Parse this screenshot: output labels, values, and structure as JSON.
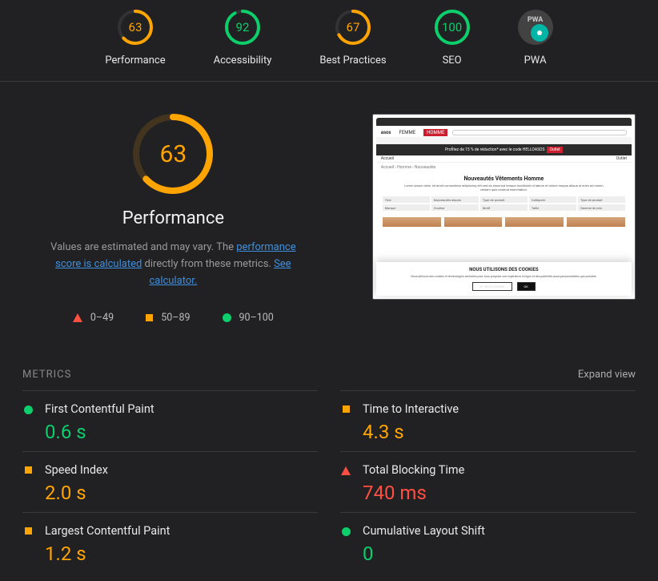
{
  "top_gauges": [
    {
      "score": 63,
      "label": "Performance",
      "color": "#ffa400"
    },
    {
      "score": 92,
      "label": "Accessibility",
      "color": "#0cce6b"
    },
    {
      "score": 67,
      "label": "Best Practices",
      "color": "#ffa400"
    },
    {
      "score": 100,
      "label": "SEO",
      "color": "#0cce6b"
    }
  ],
  "pwa_label": "PWA",
  "pwa_badge_text": "PWA",
  "big_gauge": {
    "score": 63,
    "label": "Performance",
    "color": "#ffa400"
  },
  "desc_prefix": "Values are estimated and may vary. The ",
  "desc_link1": "performance score is calculated",
  "desc_mid": " directly from these metrics. ",
  "desc_link2": "See calculator.",
  "legend": {
    "low": "0–49",
    "mid": "50–89",
    "high": "90–100"
  },
  "metrics_title": "METRICS",
  "expand_label": "Expand view",
  "metrics": [
    {
      "name": "First Contentful Paint",
      "value": "0.6 s",
      "status": "good"
    },
    {
      "name": "Time to Interactive",
      "value": "4.3 s",
      "status": "avg"
    },
    {
      "name": "Speed Index",
      "value": "2.0 s",
      "status": "avg"
    },
    {
      "name": "Total Blocking Time",
      "value": "740 ms",
      "status": "bad"
    },
    {
      "name": "Largest Contentful Paint",
      "value": "1.2 s",
      "status": "avg"
    },
    {
      "name": "Cumulative Layout Shift",
      "value": "0",
      "status": "good"
    }
  ],
  "screenshot": {
    "site": "asos",
    "tabs": [
      "FEMME",
      "HOMME"
    ],
    "banner": "Profitez de 15 % de réduction* avec le code HELLOASOS",
    "nav_left": "Accueil",
    "nav_right": "Outlet",
    "crumb": "Accueil › Homme › Nouveautés",
    "heading": "Nouveautés Vêtements Homme",
    "filters": [
      "Trier",
      "Nouveautés depuis",
      "Type de produit",
      "Catégorie",
      "Type de produit",
      "Marque",
      "Couleur",
      "Motif",
      "Taille",
      "Gamme de prix"
    ],
    "cookie_title": "NOUS UTILISONS DES COOKIES",
    "cookie_btn1": "JE VEUX CHOISIR",
    "cookie_btn2": "OK"
  }
}
